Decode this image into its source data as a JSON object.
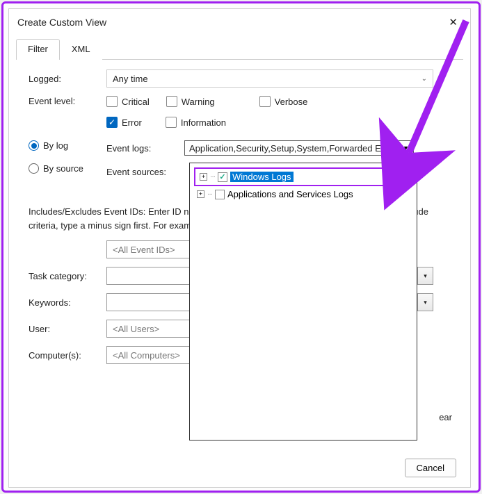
{
  "window": {
    "title": "Create Custom View"
  },
  "tabs": {
    "filter": "Filter",
    "xml": "XML"
  },
  "labels": {
    "logged": "Logged:",
    "event_level": "Event level:",
    "by_log": "By log",
    "by_source": "By source",
    "event_logs": "Event logs:",
    "event_sources": "Event sources:",
    "includes": "Includes/Excludes Event IDs: Enter ID numbers and/or ID ranges separated by commas. To exclude criteria, type a minus sign first. For example 1,3,5-99,-76",
    "task_category": "Task category:",
    "keywords": "Keywords:",
    "user": "User:",
    "computers": "Computer(s):"
  },
  "logged_value": "Any time",
  "levels": {
    "critical": "Critical",
    "warning": "Warning",
    "verbose": "Verbose",
    "error": "Error",
    "information": "Information"
  },
  "event_logs_value": "Application,Security,Setup,System,Forwarded Ev",
  "placeholders": {
    "all_event_ids": "<All Event IDs>",
    "all_users": "<All Users>",
    "all_computers": "<All Computers>"
  },
  "tree": {
    "windows_logs": "Windows Logs",
    "app_services": "Applications and Services Logs"
  },
  "buttons": {
    "clear": "Clear",
    "cancel": "Cancel"
  }
}
